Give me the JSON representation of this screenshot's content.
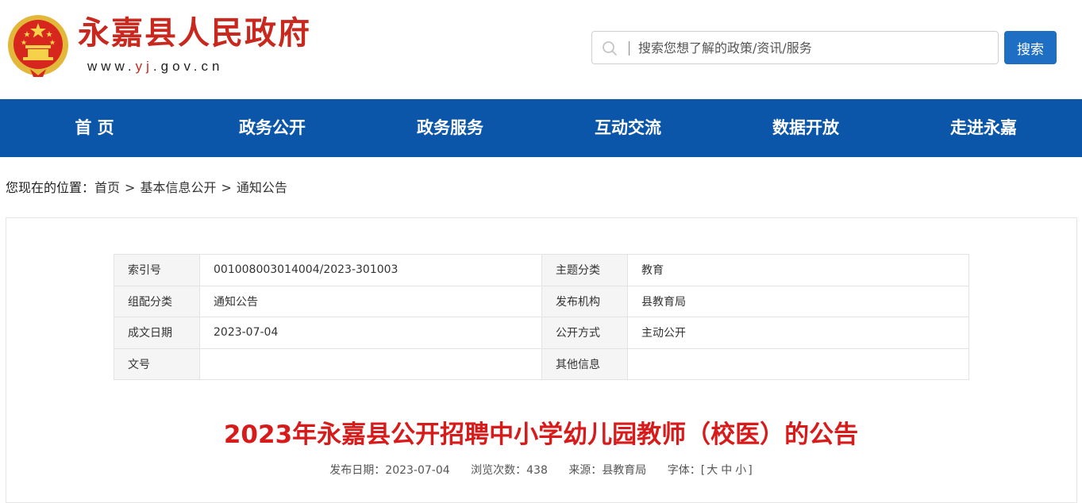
{
  "header": {
    "site_title": "永嘉县人民政府",
    "site_url_parts": [
      "www.",
      "yj",
      ".gov.cn"
    ],
    "search_placeholder": "搜索您想了解的政策/资讯/服务",
    "search_button": "搜索"
  },
  "nav": {
    "items": [
      "首 页",
      "政务公开",
      "政务服务",
      "互动交流",
      "数据开放",
      "走进永嘉"
    ]
  },
  "breadcrumb": {
    "prefix": "您现在的位置：",
    "items": [
      "首页",
      "基本信息公开",
      "通知公告"
    ],
    "separator": ">"
  },
  "info_table": {
    "rows": [
      [
        {
          "label": "索引号",
          "value": "001008003014004/2023-301003"
        },
        {
          "label": "主题分类",
          "value": "教育"
        }
      ],
      [
        {
          "label": "组配分类",
          "value": "通知公告"
        },
        {
          "label": "发布机构",
          "value": "县教育局"
        }
      ],
      [
        {
          "label": "成文日期",
          "value": "2023-07-04"
        },
        {
          "label": "公开方式",
          "value": "主动公开"
        }
      ],
      [
        {
          "label": "文号",
          "value": ""
        },
        {
          "label": "其他信息",
          "value": ""
        }
      ]
    ]
  },
  "article": {
    "title": "2023年永嘉县公开招聘中小学幼儿园教师（校医）的公告",
    "publish_date_label": "发布日期：",
    "publish_date": "2023-07-04",
    "views_label": "浏览次数：",
    "views": "438",
    "source_label": "来源：",
    "source": "县教育局",
    "font_label": "字体：",
    "font_open": "[",
    "font_sizes": [
      "大",
      "中",
      "小"
    ],
    "font_close": "]"
  },
  "colors": {
    "brand_red": "#c8281e",
    "nav_blue": "#0b56a8",
    "button_blue": "#1e6fc4",
    "title_red": "#d71b1b"
  },
  "icons": [
    "national-emblem-icon",
    "search-icon"
  ]
}
